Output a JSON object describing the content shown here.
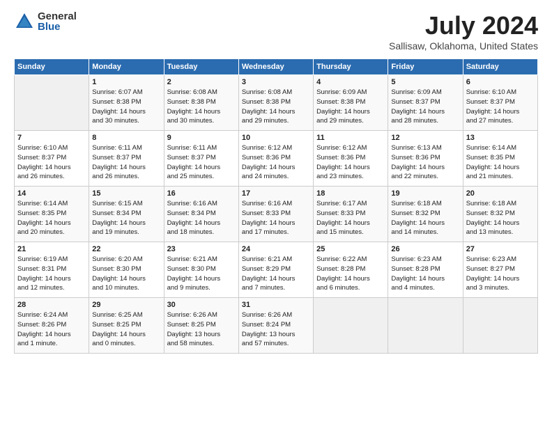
{
  "logo": {
    "general": "General",
    "blue": "Blue"
  },
  "title": "July 2024",
  "subtitle": "Sallisaw, Oklahoma, United States",
  "days_header": [
    "Sunday",
    "Monday",
    "Tuesday",
    "Wednesday",
    "Thursday",
    "Friday",
    "Saturday"
  ],
  "weeks": [
    [
      {
        "day": "",
        "info": ""
      },
      {
        "day": "1",
        "info": "Sunrise: 6:07 AM\nSunset: 8:38 PM\nDaylight: 14 hours\nand 30 minutes."
      },
      {
        "day": "2",
        "info": "Sunrise: 6:08 AM\nSunset: 8:38 PM\nDaylight: 14 hours\nand 30 minutes."
      },
      {
        "day": "3",
        "info": "Sunrise: 6:08 AM\nSunset: 8:38 PM\nDaylight: 14 hours\nand 29 minutes."
      },
      {
        "day": "4",
        "info": "Sunrise: 6:09 AM\nSunset: 8:38 PM\nDaylight: 14 hours\nand 29 minutes."
      },
      {
        "day": "5",
        "info": "Sunrise: 6:09 AM\nSunset: 8:37 PM\nDaylight: 14 hours\nand 28 minutes."
      },
      {
        "day": "6",
        "info": "Sunrise: 6:10 AM\nSunset: 8:37 PM\nDaylight: 14 hours\nand 27 minutes."
      }
    ],
    [
      {
        "day": "7",
        "info": "Sunrise: 6:10 AM\nSunset: 8:37 PM\nDaylight: 14 hours\nand 26 minutes."
      },
      {
        "day": "8",
        "info": "Sunrise: 6:11 AM\nSunset: 8:37 PM\nDaylight: 14 hours\nand 26 minutes."
      },
      {
        "day": "9",
        "info": "Sunrise: 6:11 AM\nSunset: 8:37 PM\nDaylight: 14 hours\nand 25 minutes."
      },
      {
        "day": "10",
        "info": "Sunrise: 6:12 AM\nSunset: 8:36 PM\nDaylight: 14 hours\nand 24 minutes."
      },
      {
        "day": "11",
        "info": "Sunrise: 6:12 AM\nSunset: 8:36 PM\nDaylight: 14 hours\nand 23 minutes."
      },
      {
        "day": "12",
        "info": "Sunrise: 6:13 AM\nSunset: 8:36 PM\nDaylight: 14 hours\nand 22 minutes."
      },
      {
        "day": "13",
        "info": "Sunrise: 6:14 AM\nSunset: 8:35 PM\nDaylight: 14 hours\nand 21 minutes."
      }
    ],
    [
      {
        "day": "14",
        "info": "Sunrise: 6:14 AM\nSunset: 8:35 PM\nDaylight: 14 hours\nand 20 minutes."
      },
      {
        "day": "15",
        "info": "Sunrise: 6:15 AM\nSunset: 8:34 PM\nDaylight: 14 hours\nand 19 minutes."
      },
      {
        "day": "16",
        "info": "Sunrise: 6:16 AM\nSunset: 8:34 PM\nDaylight: 14 hours\nand 18 minutes."
      },
      {
        "day": "17",
        "info": "Sunrise: 6:16 AM\nSunset: 8:33 PM\nDaylight: 14 hours\nand 17 minutes."
      },
      {
        "day": "18",
        "info": "Sunrise: 6:17 AM\nSunset: 8:33 PM\nDaylight: 14 hours\nand 15 minutes."
      },
      {
        "day": "19",
        "info": "Sunrise: 6:18 AM\nSunset: 8:32 PM\nDaylight: 14 hours\nand 14 minutes."
      },
      {
        "day": "20",
        "info": "Sunrise: 6:18 AM\nSunset: 8:32 PM\nDaylight: 14 hours\nand 13 minutes."
      }
    ],
    [
      {
        "day": "21",
        "info": "Sunrise: 6:19 AM\nSunset: 8:31 PM\nDaylight: 14 hours\nand 12 minutes."
      },
      {
        "day": "22",
        "info": "Sunrise: 6:20 AM\nSunset: 8:30 PM\nDaylight: 14 hours\nand 10 minutes."
      },
      {
        "day": "23",
        "info": "Sunrise: 6:21 AM\nSunset: 8:30 PM\nDaylight: 14 hours\nand 9 minutes."
      },
      {
        "day": "24",
        "info": "Sunrise: 6:21 AM\nSunset: 8:29 PM\nDaylight: 14 hours\nand 7 minutes."
      },
      {
        "day": "25",
        "info": "Sunrise: 6:22 AM\nSunset: 8:28 PM\nDaylight: 14 hours\nand 6 minutes."
      },
      {
        "day": "26",
        "info": "Sunrise: 6:23 AM\nSunset: 8:28 PM\nDaylight: 14 hours\nand 4 minutes."
      },
      {
        "day": "27",
        "info": "Sunrise: 6:23 AM\nSunset: 8:27 PM\nDaylight: 14 hours\nand 3 minutes."
      }
    ],
    [
      {
        "day": "28",
        "info": "Sunrise: 6:24 AM\nSunset: 8:26 PM\nDaylight: 14 hours\nand 1 minute."
      },
      {
        "day": "29",
        "info": "Sunrise: 6:25 AM\nSunset: 8:25 PM\nDaylight: 14 hours\nand 0 minutes."
      },
      {
        "day": "30",
        "info": "Sunrise: 6:26 AM\nSunset: 8:25 PM\nDaylight: 13 hours\nand 58 minutes."
      },
      {
        "day": "31",
        "info": "Sunrise: 6:26 AM\nSunset: 8:24 PM\nDaylight: 13 hours\nand 57 minutes."
      },
      {
        "day": "",
        "info": ""
      },
      {
        "day": "",
        "info": ""
      },
      {
        "day": "",
        "info": ""
      }
    ]
  ]
}
